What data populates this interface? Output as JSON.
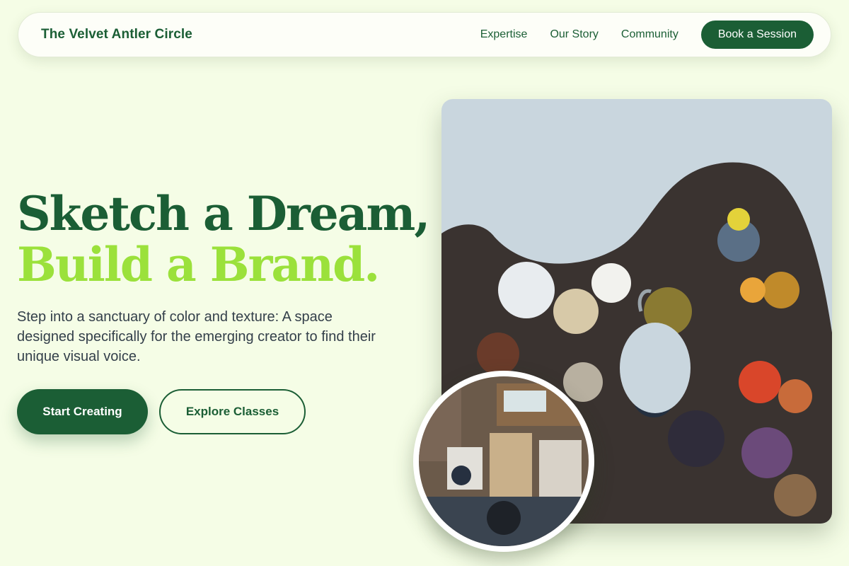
{
  "nav": {
    "brand": "The Velvet Antler Circle",
    "links": [
      "Expertise",
      "Our Story",
      "Community"
    ],
    "cta": "Book a Session"
  },
  "hero": {
    "title_line1": "Sketch a Dream,",
    "title_line2": "Build a Brand.",
    "description": "Step into a sanctuary of color and texture: A space designed specifically for the emerging creator to find their unique visual voice.",
    "primary_button": "Start Creating",
    "secondary_button": "Explore Classes"
  },
  "colors": {
    "background": "#f5fde6",
    "brand_green": "#1b5e35",
    "accent_lime": "#9be13b",
    "body_text": "#333f4a"
  },
  "images": {
    "main": "paint-palette-photo",
    "inset": "art-studio-photo"
  }
}
